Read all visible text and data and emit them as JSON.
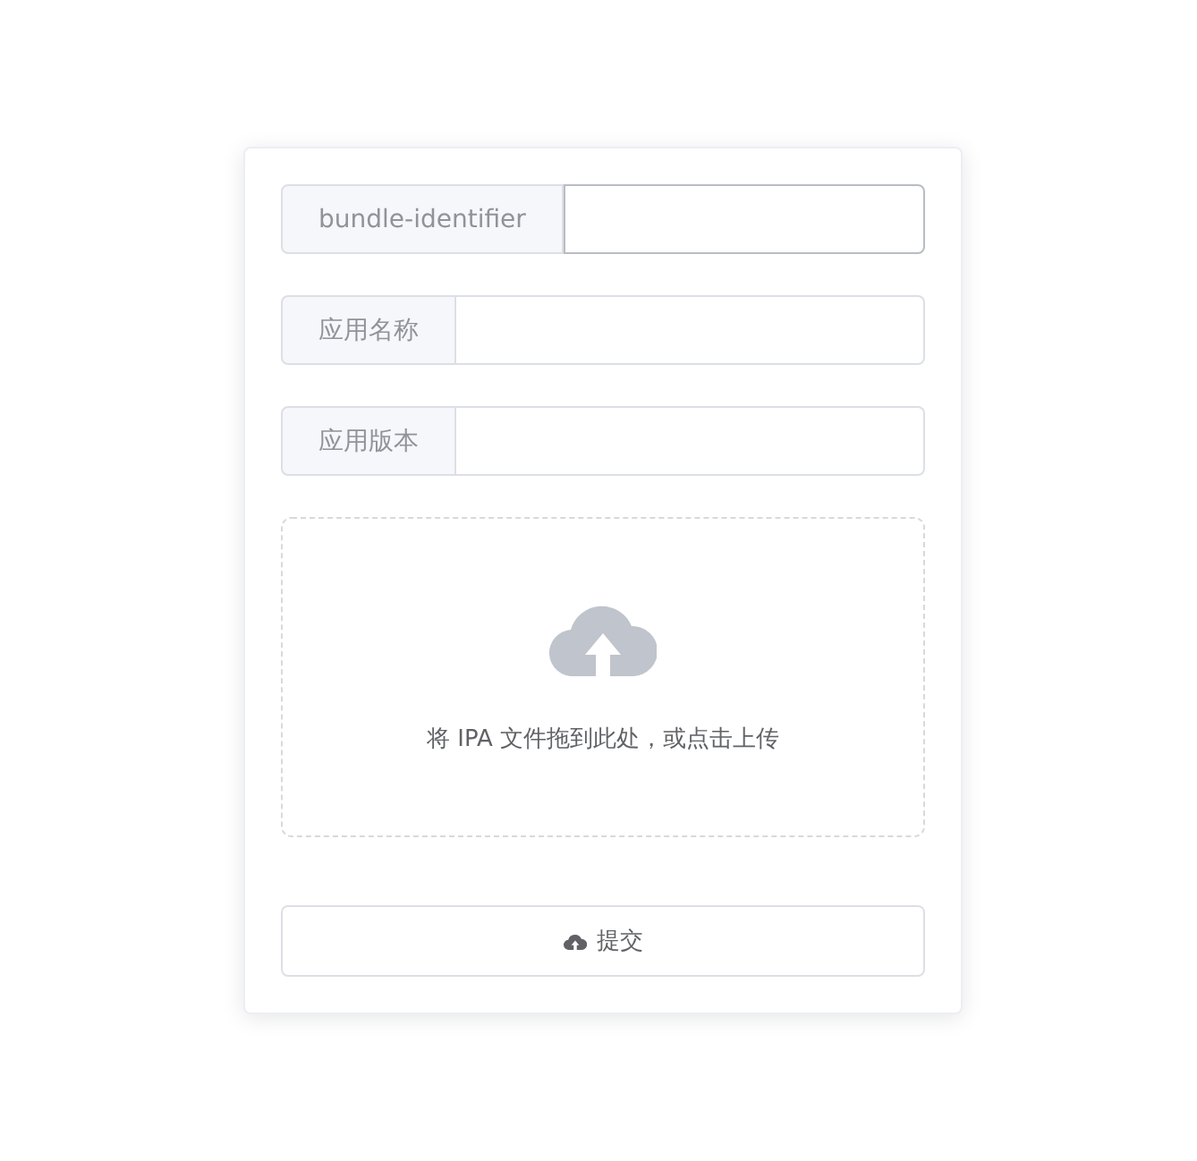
{
  "fields": [
    {
      "label": "bundle-identifier",
      "focused": true
    },
    {
      "label": "应用名称",
      "focused": false
    },
    {
      "label": "应用版本",
      "focused": false
    }
  ],
  "upload": {
    "text": "将 IPA 文件拖到此处，或点击上传"
  },
  "submit_button": {
    "label": "提交"
  }
}
